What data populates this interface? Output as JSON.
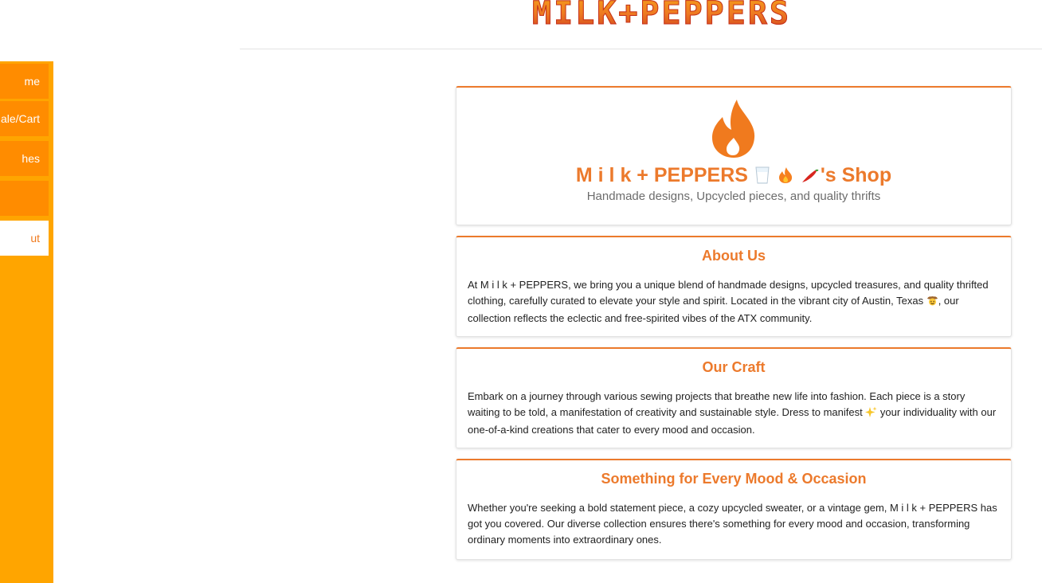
{
  "header": {
    "logo_text": "MILK+PEPPERS"
  },
  "sidebar": {
    "items": [
      {
        "label": "Home",
        "visible": "me"
      },
      {
        "label": "Sale/Cart",
        "visible": "ale/Cart"
      },
      {
        "label": "Clothes",
        "visible": "hes"
      },
      {
        "label": "",
        "visible": ""
      },
      {
        "label": "About",
        "visible": "ut",
        "active": true
      }
    ]
  },
  "hero": {
    "icon": "flame-icon",
    "brand": "M i l k + PEPPERS",
    "shop_suffix": "'s Shop",
    "title_icons": [
      "milk-glass-icon",
      "fire-icon",
      "chili-pepper-icon"
    ],
    "tagline": "Handmade designs, Upcycled pieces, and quality thrifts"
  },
  "about": {
    "title": "About Us",
    "body_before_icon": "At M i l k + PEPPERS, we bring you a unique blend of handmade designs, upcycled treasures, and quality thrifted clothing, carefully curated to elevate your style and spirit. Located in the vibrant city of Austin, Texas ",
    "icon": "cowboy-face-icon",
    "body_after_icon": ", our collection reflects the eclectic and free-spirited vibes of the ATX community."
  },
  "craft": {
    "title": "Our Craft",
    "body_before_icon": "Embark on a journey through various sewing projects that breathe new life into fashion. Each piece is a story waiting to be told, a manifestation of creativity and sustainable style. Dress to manifest ",
    "icon": "sparkles-icon",
    "body_after_icon": " your individuality with our one-of-a-kind creations that cater to every mood and occasion."
  },
  "mood": {
    "title": "Something for Every Mood & Occasion",
    "body": "Whether you're seeking a bold statement piece, a cozy upcycled sweater, or a vintage gem, M i l k + PEPPERS has got you covered. Our diverse collection ensures there's something for every mood and occasion, transforming ordinary moments into extraordinary ones."
  },
  "colors": {
    "accent": "#ec7a2c",
    "sidebar_bg": "#ffa500",
    "nav_item_bg": "#ff8c00",
    "text": "#222222",
    "muted": "#6c6c6c"
  }
}
